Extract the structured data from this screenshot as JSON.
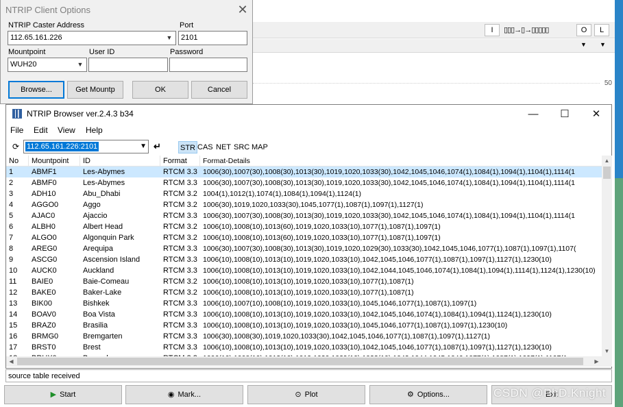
{
  "background_app": {
    "toolbar_buttons": [
      "I",
      "O",
      "L"
    ],
    "toolbar_glyphs": "▯▯▯→▯→▯▯▯▯▯",
    "chart_tick": "50"
  },
  "client_dialog": {
    "title": "NTRIP Client Options",
    "caster_address_label": "NTRIP Caster Address",
    "caster_address_value": "112.65.161.226",
    "port_label": "Port",
    "port_value": "2101",
    "mountpoint_label": "Mountpoint",
    "mountpoint_value": "WUH20",
    "user_id_label": "User ID",
    "user_id_value": "",
    "password_label": "Password",
    "password_value": "",
    "browse_label": "Browse...",
    "get_mountp_label": "Get Mountp",
    "ok_label": "OK",
    "cancel_label": "Cancel"
  },
  "browser": {
    "title": "NTRIP Browser ver.2.4.3 b34",
    "menu": [
      "File",
      "Edit",
      "View",
      "Help"
    ],
    "caster_combo_value": "112.65.161.226:2101",
    "filter_tabs": [
      "STR",
      "CAS",
      "NET",
      "SRC",
      "MAP"
    ],
    "active_tab": "STR",
    "columns": [
      "No",
      "Mountpoint",
      "ID",
      "Format",
      "Format-Details"
    ],
    "rows": [
      [
        "1",
        "ABMF1",
        "Les-Abymes",
        "RTCM 3.3",
        "1006(30),1007(30),1008(30),1013(30),1019,1020,1033(30),1042,1045,1046,1074(1),1084(1),1094(1),1104(1),1114(1"
      ],
      [
        "2",
        "ABMF0",
        "Les-Abymes",
        "RTCM 3.3",
        "1006(30),1007(30),1008(30),1013(30),1019,1020,1033(30),1042,1045,1046,1074(1),1084(1),1094(1),1104(1),1114(1"
      ],
      [
        "3",
        "ADH10",
        "Abu_Dhabi",
        "RTCM 3.2",
        "1004(1),1012(1),1074(1),1084(1),1094(1),1124(1)"
      ],
      [
        "4",
        "AGGO0",
        "Aggo",
        "RTCM 3.2",
        "1006(30),1019,1020,1033(30),1045,1077(1),1087(1),1097(1),1127(1)"
      ],
      [
        "5",
        "AJAC0",
        "Ajaccio",
        "RTCM 3.3",
        "1006(30),1007(30),1008(30),1013(30),1019,1020,1033(30),1042,1045,1046,1074(1),1084(1),1094(1),1104(1),1114(1"
      ],
      [
        "6",
        "ALBH0",
        "Albert Head",
        "RTCM 3.2",
        "1006(10),1008(10),1013(60),1019,1020,1033(10),1077(1),1087(1),1097(1)"
      ],
      [
        "7",
        "ALGO0",
        "Algonquin Park",
        "RTCM 3.2",
        "1006(10),1008(10),1013(60),1019,1020,1033(10),1077(1),1087(1),1097(1)"
      ],
      [
        "8",
        "AREG0",
        "Arequipa",
        "RTCM 3.3",
        "1006(30),1007(30),1008(30),1013(30),1019,1020,1029(30),1033(30),1042,1045,1046,1077(1),1087(1),1097(1),1107("
      ],
      [
        "9",
        "ASCG0",
        "Ascension Island",
        "RTCM 3.3",
        "1006(10),1008(10),1013(10),1019,1020,1033(10),1042,1045,1046,1077(1),1087(1),1097(1),1127(1),1230(10)"
      ],
      [
        "10",
        "AUCK0",
        "Auckland",
        "RTCM 3.3",
        "1006(10),1008(10),1013(10),1019,1020,1033(10),1042,1044,1045,1046,1074(1),1084(1),1094(1),1114(1),1124(1),1230(10)"
      ],
      [
        "11",
        "BAIE0",
        "Baie-Comeau",
        "RTCM 3.2",
        "1006(10),1008(10),1013(10),1019,1020,1033(10),1077(1),1087(1)"
      ],
      [
        "12",
        "BAKE0",
        "Baker-Lake",
        "RTCM 3.2",
        "1006(10),1008(10),1013(10),1019,1020,1033(10),1077(1),1087(1)"
      ],
      [
        "13",
        "BIK00",
        "Bishkek",
        "RTCM 3.3",
        "1006(10),1007(10),1008(10),1019,1020,1033(10),1045,1046,1077(1),1087(1),1097(1)"
      ],
      [
        "14",
        "BOAV0",
        "Boa Vista",
        "RTCM 3.3",
        "1006(10),1008(10),1013(10),1019,1020,1033(10),1042,1045,1046,1074(1),1084(1),1094(1),1124(1),1230(10)"
      ],
      [
        "15",
        "BRAZ0",
        "Brasilia",
        "RTCM 3.3",
        "1006(10),1008(10),1013(10),1019,1020,1033(10),1045,1046,1077(1),1087(1),1097(1),1230(10)"
      ],
      [
        "16",
        "BRMG0",
        "Bremgarten",
        "RTCM 3.3",
        "1006(30),1008(30),1019,1020,1033(30),1042,1045,1046,1077(1),1087(1),1097(1),1127(1)"
      ],
      [
        "17",
        "BRST0",
        "Brest",
        "RTCM 3.3",
        "1006(10),1008(10),1013(10),1019,1020,1033(10),1042,1045,1046,1077(1),1087(1),1097(1),1127(1),1230(10)"
      ],
      [
        "18",
        "BRUX0",
        "Brussels",
        "RTCM 3.3",
        "1006(10),1008(10),1013(10),1019,1020,1029(10),1033(10),1042,1044,1045,1046,1077(1),1087(1),1097(1),1107(1"
      ]
    ],
    "status": "source table received",
    "buttons": {
      "start": "Start",
      "mark": "Mark...",
      "plot": "Plot",
      "options": "Options...",
      "exit": "Exit"
    }
  },
  "watermark": "CSDN @PhD.Knight"
}
